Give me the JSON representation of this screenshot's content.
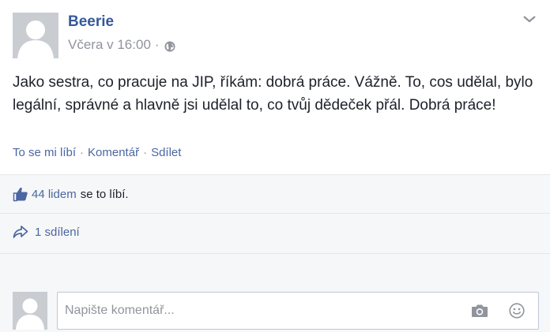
{
  "post": {
    "author": "Beerie",
    "timestamp": "Včera v 16:00",
    "separator": "·",
    "privacy_icon": "globe-icon",
    "menu_icon": "chevron-down-icon",
    "text": "Jako sestra, co pracuje na JIP, říkám: dobrá práce. Vážně. To, cos udělal, bylo legální, správné a hlavně jsi udělal to, co tvůj dědeček přál. Dobrá práce!"
  },
  "actions": {
    "like": "To se mi líbí",
    "comment": "Komentář",
    "share": "Sdílet",
    "dot": "·"
  },
  "feedback": {
    "like_icon": "thumbs-up-icon",
    "likes_count": "44 lidem",
    "likes_suffix": "se to líbí.",
    "share_icon": "share-arrow-icon",
    "shares_count": "1 sdílení"
  },
  "composer": {
    "placeholder": "Napište komentář...",
    "camera_icon": "camera-icon",
    "emoji_icon": "smiley-icon"
  },
  "colors": {
    "link": "#365899",
    "secondary_text": "#90949c",
    "feedback_bg": "#f6f7f9",
    "avatar_placeholder": "#c9ccd1"
  }
}
